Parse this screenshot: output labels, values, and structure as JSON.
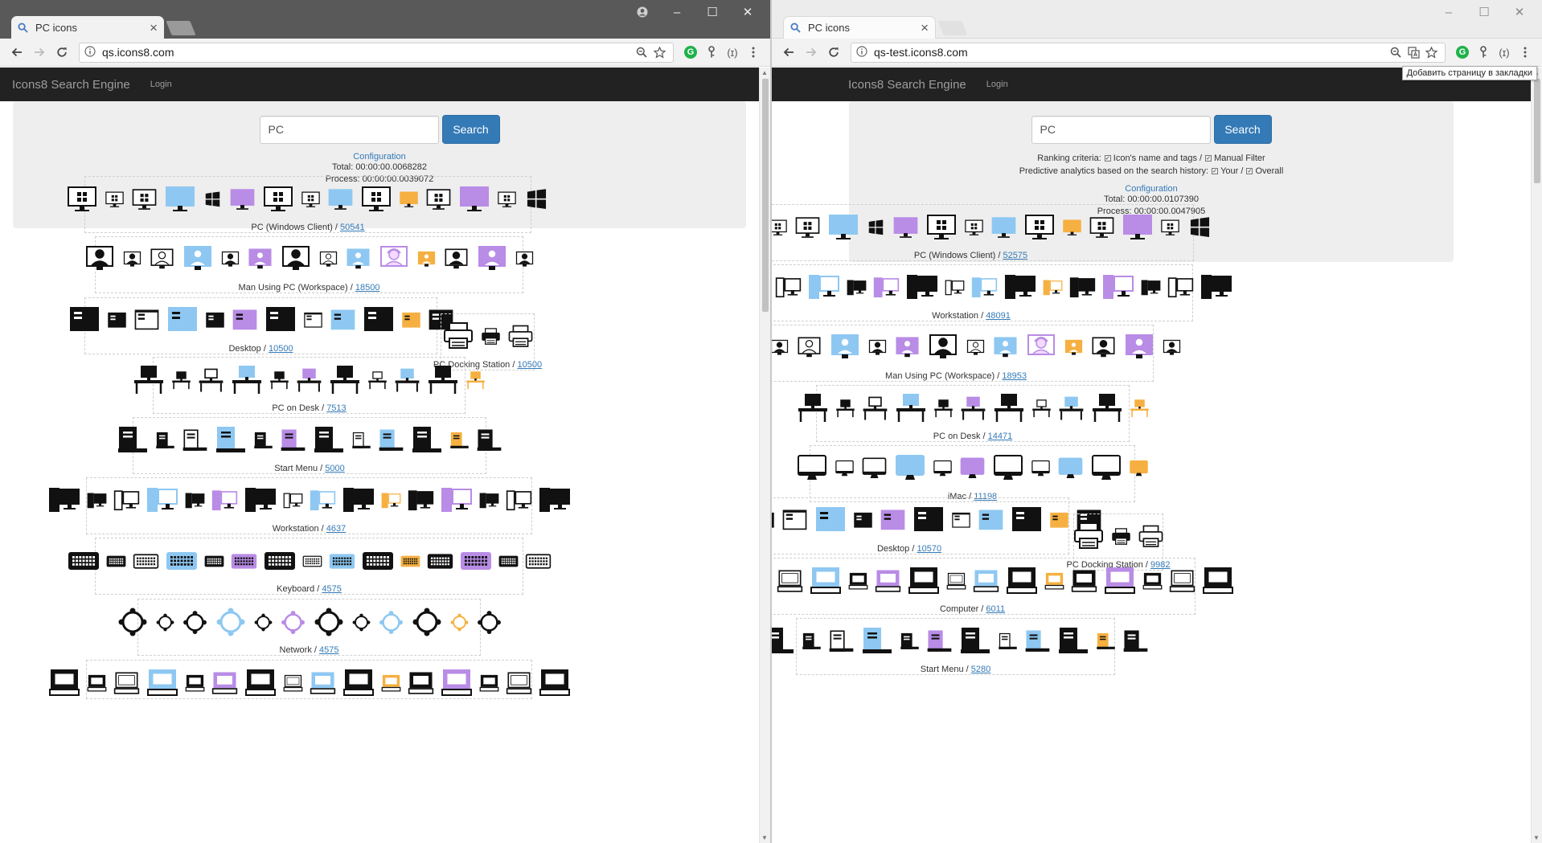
{
  "colors": {
    "brand_primary": "#337ab7",
    "navbar_bg": "#222222",
    "jumbotron_bg": "#eeeeee",
    "icon_blue": "#8ec8f2",
    "icon_purple": "#b98ce6",
    "icon_orange": "#f5b041"
  },
  "left": {
    "tab_title": "PC icons",
    "url": "qs.icons8.com",
    "navbar": {
      "brand": "Icons8 Search Engine",
      "login": "Login"
    },
    "search": {
      "value": "PC",
      "button": "Search"
    },
    "configuration": "Configuration",
    "total": "Total: 00:00:00.0068282",
    "process": "Process: 00:00:00.0039072",
    "groups": [
      {
        "name": "PC (Windows Client)",
        "count": "50541",
        "icons": [
          "monitor-windows-icon",
          "monitor-windows-icon",
          "monitor-windows-icon",
          "monitor-windows-icon",
          "windows-logo-icon",
          "monitor-windows-icon",
          "monitor-windows-icon",
          "monitor-windows-icon",
          "monitor-windows-icon",
          "monitor-windows-icon",
          "monitor-windows-icon",
          "monitor-windows-icon",
          "monitor-windows-icon",
          "monitor-windows-icon",
          "windows-logo-icon"
        ]
      },
      {
        "name": "Man Using PC (Workspace)",
        "count": "18500",
        "icons": [
          "man-at-pc-icon",
          "man-at-pc-icon",
          "man-at-pc-icon",
          "man-at-pc-icon",
          "man-at-pc-icon",
          "man-at-pc-icon",
          "man-at-pc-icon",
          "man-at-pc-icon",
          "man-at-pc-icon",
          "woman-at-pc-icon",
          "man-at-pc-icon",
          "man-at-pc-icon",
          "man-at-pc-icon",
          "man-at-pc-icon"
        ]
      },
      {
        "name": "Desktop",
        "count": "10500",
        "icons": [
          "desktop-screen-icon",
          "desktop-screen-icon",
          "desktop-screen-icon",
          "desktop-screen-icon",
          "desktop-screen-icon",
          "desktop-screen-icon",
          "desktop-screen-icon",
          "desktop-screen-icon",
          "desktop-screen-icon",
          "desktop-screen-icon",
          "desktop-screen-icon",
          "desktop-screen-icon"
        ]
      },
      {
        "name": "PC Docking Station",
        "count": "10500",
        "icons": [
          "printer-icon",
          "printer-icon",
          "printer-icon"
        ]
      },
      {
        "name": "PC on Desk",
        "count": "7513",
        "icons": [
          "pc-on-desk-icon",
          "pc-on-desk-icon",
          "pc-on-desk-icon",
          "pc-on-desk-icon",
          "pc-on-desk-icon",
          "pc-on-desk-icon",
          "pc-on-desk-icon",
          "pc-on-desk-icon",
          "pc-on-desk-icon",
          "pc-on-desk-icon",
          "pc-on-desk-icon"
        ]
      },
      {
        "name": "Start Menu",
        "count": "5000",
        "icons": [
          "pc-tower-icon",
          "pc-tower-icon",
          "pc-tower-icon",
          "pc-tower-icon",
          "pc-tower-icon",
          "pc-tower-icon",
          "pc-tower-icon",
          "pc-tower-icon",
          "pc-tower-icon",
          "pc-tower-icon",
          "pc-tower-icon",
          "pc-tower-icon"
        ]
      },
      {
        "name": "Workstation",
        "count": "4637",
        "icons": [
          "workstation-icon",
          "workstation-icon",
          "workstation-icon",
          "workstation-icon",
          "workstation-icon",
          "workstation-icon",
          "workstation-icon",
          "workstation-icon",
          "workstation-icon",
          "workstation-icon",
          "workstation-icon",
          "workstation-icon",
          "workstation-icon",
          "workstation-icon",
          "workstation-icon",
          "workstation-icon"
        ]
      },
      {
        "name": "Keyboard",
        "count": "4575",
        "icons": [
          "keyboard-icon",
          "keyboard-icon",
          "keyboard-icon",
          "keyboard-icon",
          "keyboard-icon",
          "keyboard-icon",
          "keyboard-icon",
          "keyboard-icon",
          "keyboard-icon",
          "keyboard-icon",
          "keyboard-icon",
          "keyboard-icon",
          "keyboard-icon",
          "keyboard-icon",
          "keyboard-icon"
        ]
      },
      {
        "name": "Network",
        "count": "4575",
        "icons": [
          "network-icon",
          "network-icon",
          "network-icon",
          "network-icon",
          "network-icon",
          "network-icon",
          "network-icon",
          "network-icon",
          "network-icon",
          "network-icon",
          "network-icon",
          "network-icon"
        ]
      },
      {
        "name": "",
        "count": "",
        "icons": [
          "computer-icon",
          "computer-icon",
          "computer-icon",
          "computer-icon",
          "computer-icon",
          "computer-icon",
          "computer-icon",
          "computer-icon",
          "computer-icon",
          "computer-icon",
          "computer-icon",
          "computer-icon",
          "computer-icon",
          "computer-icon",
          "computer-icon",
          "computer-icon"
        ]
      }
    ]
  },
  "right": {
    "tab_title": "PC icons",
    "url": "qs-test.icons8.com",
    "tooltip": "Добавить страницу в закладки",
    "navbar": {
      "brand": "Icons8 Search Engine",
      "login": "Login"
    },
    "search": {
      "value": "PC",
      "button": "Search"
    },
    "ranking_label": "Ranking criteria:",
    "ranking_opt1": "Icon's name and tags /",
    "ranking_opt2": "Manual Filter",
    "predictive_label": "Predictive analytics based on the search history:",
    "predictive_opt1": "Your /",
    "predictive_opt2": "Overall",
    "configuration": "Configuration",
    "total": "Total: 00:00:00.0107390",
    "process": "Process: 00:00:00.0047905",
    "groups": [
      {
        "name": "PC (Windows Client)",
        "count": "52575",
        "icons": [
          "monitor-windows-icon",
          "monitor-windows-icon",
          "monitor-windows-icon",
          "monitor-windows-icon",
          "windows-logo-icon",
          "monitor-windows-icon",
          "monitor-windows-icon",
          "monitor-windows-icon",
          "monitor-windows-icon",
          "monitor-windows-icon",
          "monitor-windows-icon",
          "monitor-windows-icon",
          "monitor-windows-icon",
          "monitor-windows-icon",
          "windows-logo-icon"
        ]
      },
      {
        "name": "Workstation",
        "count": "48091",
        "icons": [
          "workstation-icon",
          "workstation-icon",
          "workstation-icon",
          "workstation-icon",
          "workstation-icon",
          "workstation-icon",
          "workstation-icon",
          "workstation-icon",
          "workstation-icon",
          "workstation-icon",
          "workstation-icon",
          "workstation-icon",
          "workstation-icon",
          "workstation-icon",
          "workstation-icon",
          "workstation-icon"
        ]
      },
      {
        "name": "Man Using PC (Workspace)",
        "count": "18953",
        "icons": [
          "man-at-pc-icon",
          "man-at-pc-icon",
          "man-at-pc-icon",
          "man-at-pc-icon",
          "man-at-pc-icon",
          "man-at-pc-icon",
          "man-at-pc-icon",
          "man-at-pc-icon",
          "man-at-pc-icon",
          "woman-at-pc-icon",
          "man-at-pc-icon",
          "man-at-pc-icon",
          "man-at-pc-icon",
          "man-at-pc-icon"
        ]
      },
      {
        "name": "PC on Desk",
        "count": "14471",
        "icons": [
          "pc-on-desk-icon",
          "pc-on-desk-icon",
          "pc-on-desk-icon",
          "pc-on-desk-icon",
          "pc-on-desk-icon",
          "pc-on-desk-icon",
          "pc-on-desk-icon",
          "pc-on-desk-icon",
          "pc-on-desk-icon",
          "pc-on-desk-icon",
          "pc-on-desk-icon"
        ]
      },
      {
        "name": "iMac",
        "count": "11198",
        "icons": [
          "imac-icon",
          "imac-icon",
          "imac-icon",
          "imac-icon",
          "imac-icon",
          "imac-icon",
          "imac-icon",
          "imac-icon",
          "imac-icon",
          "imac-icon",
          "imac-icon"
        ]
      },
      {
        "name": "Desktop",
        "count": "10570",
        "icons": [
          "desktop-screen-icon",
          "desktop-screen-icon",
          "desktop-screen-icon",
          "desktop-screen-icon",
          "desktop-screen-icon",
          "desktop-screen-icon",
          "desktop-screen-icon",
          "desktop-screen-icon",
          "desktop-screen-icon",
          "desktop-screen-icon",
          "desktop-screen-icon",
          "desktop-screen-icon"
        ]
      },
      {
        "name": "PC Docking Station",
        "count": "9982",
        "icons": [
          "printer-icon",
          "printer-icon",
          "printer-icon"
        ]
      },
      {
        "name": "Computer",
        "count": "6011",
        "icons": [
          "computer-icon",
          "computer-icon",
          "computer-icon",
          "computer-icon",
          "computer-icon",
          "computer-icon",
          "computer-icon",
          "computer-icon",
          "computer-icon",
          "computer-icon",
          "computer-icon",
          "computer-icon",
          "computer-icon",
          "computer-icon",
          "computer-icon",
          "computer-icon"
        ]
      },
      {
        "name": "Start Menu",
        "count": "5280",
        "icons": [
          "pc-tower-icon",
          "pc-tower-icon",
          "pc-tower-icon",
          "pc-tower-icon",
          "pc-tower-icon",
          "pc-tower-icon",
          "pc-tower-icon",
          "pc-tower-icon",
          "pc-tower-icon",
          "pc-tower-icon",
          "pc-tower-icon",
          "pc-tower-icon"
        ]
      }
    ]
  }
}
